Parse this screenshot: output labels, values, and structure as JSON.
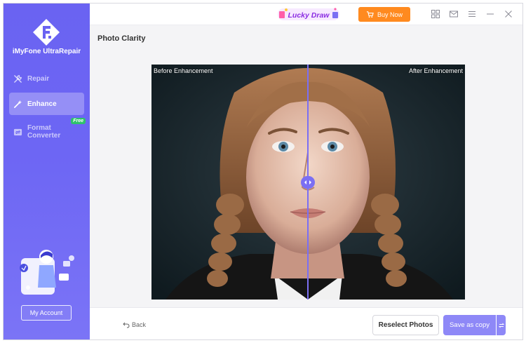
{
  "app": {
    "name": "iMyFone UltraRepair"
  },
  "sidebar": {
    "items": [
      {
        "label": "Repair",
        "icon": "wrench-icon",
        "active": false
      },
      {
        "label": "Enhance",
        "icon": "magic-wand-icon",
        "active": true
      },
      {
        "label": "Format Converter",
        "icon": "convert-icon",
        "active": false,
        "badge": "Free"
      }
    ],
    "account_label": "My Account"
  },
  "topbar": {
    "promo_label": "Lucky Draw",
    "buy_label": "Buy Now",
    "icons": [
      "grid-icon",
      "mail-icon",
      "menu-icon",
      "minimize-icon",
      "close-icon"
    ]
  },
  "main": {
    "title": "Photo Clarity",
    "before_label": "Before Enhancement",
    "after_label": "After Enhancement"
  },
  "bottombar": {
    "back_label": "Back",
    "reselect_label": "Reselect Photos",
    "save_label": "Save as copy"
  },
  "colors": {
    "accent": "#6c65f3",
    "buy": "#ff8a1f",
    "badge": "#2fc26b",
    "save": "#8e88f7"
  }
}
